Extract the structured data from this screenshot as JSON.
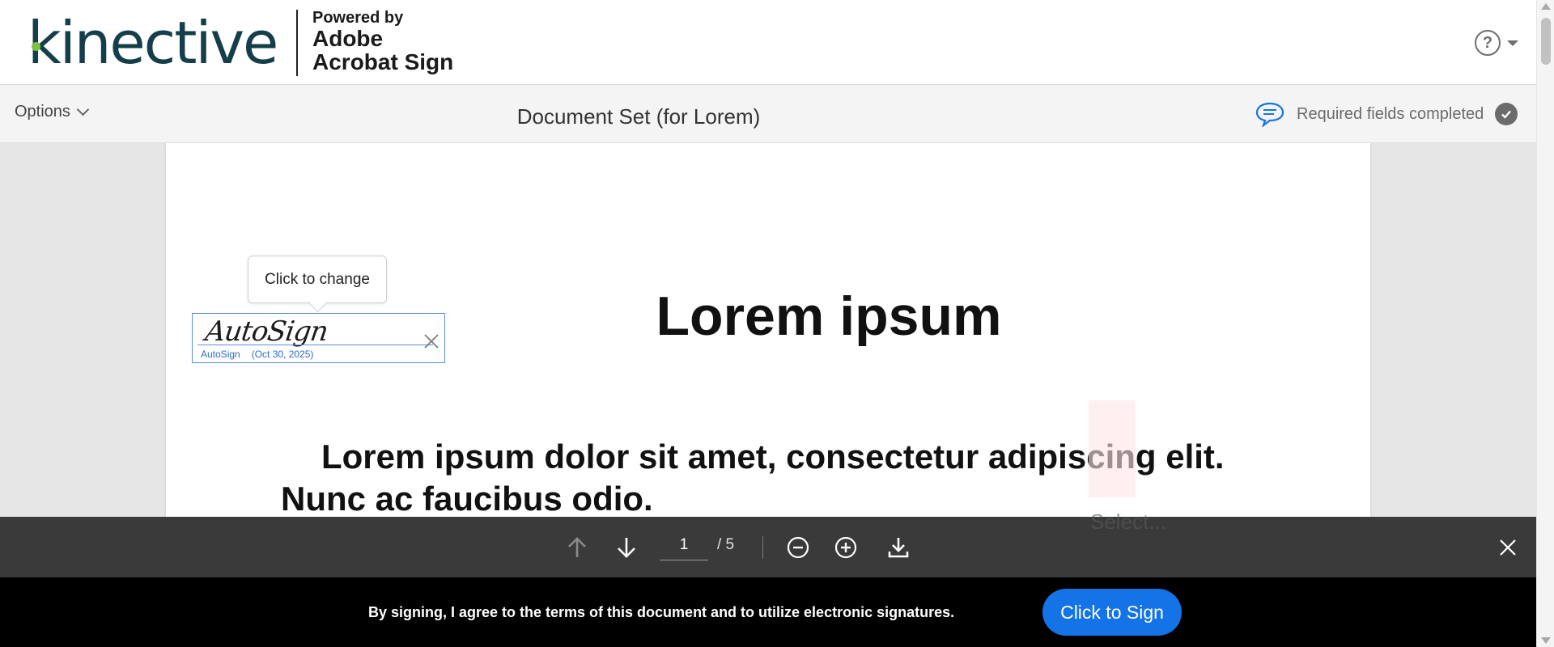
{
  "header": {
    "logo_text": "kinective",
    "powered_by": "Powered by",
    "powered_line2": "Adobe",
    "powered_line3": "Acrobat Sign",
    "help_icon": "question-circle-icon"
  },
  "toolbar": {
    "options_label": "Options",
    "document_title": "Document Set (for Lorem)",
    "status_text": "Required fields completed",
    "comment_icon": "speech-bubble-icon",
    "status_icon": "check-circle-icon"
  },
  "document": {
    "heading": "Lorem ipsum",
    "body": "Lorem ipsum dolor sit amet, consectetur adipiscing elit. Nunc ac faucibus odio.",
    "tooltip": "Click to change",
    "signature": {
      "script": "AutoSign",
      "name": "AutoSign",
      "date": "(Oct 30, 2025)"
    },
    "ghost_select": "Select..."
  },
  "navigation": {
    "current_page": "1",
    "total_pages": "/ 5"
  },
  "signbar": {
    "consent_text": "By signing, I agree to the terms of this document and to utilize electronic signatures.",
    "sign_button": "Click to Sign"
  },
  "colors": {
    "accent": "#1473e6",
    "brand_teal": "#143f4a",
    "brand_green": "#7cc242",
    "nav_bg": "#3a3a3a",
    "sign_bar_bg": "#000000"
  }
}
